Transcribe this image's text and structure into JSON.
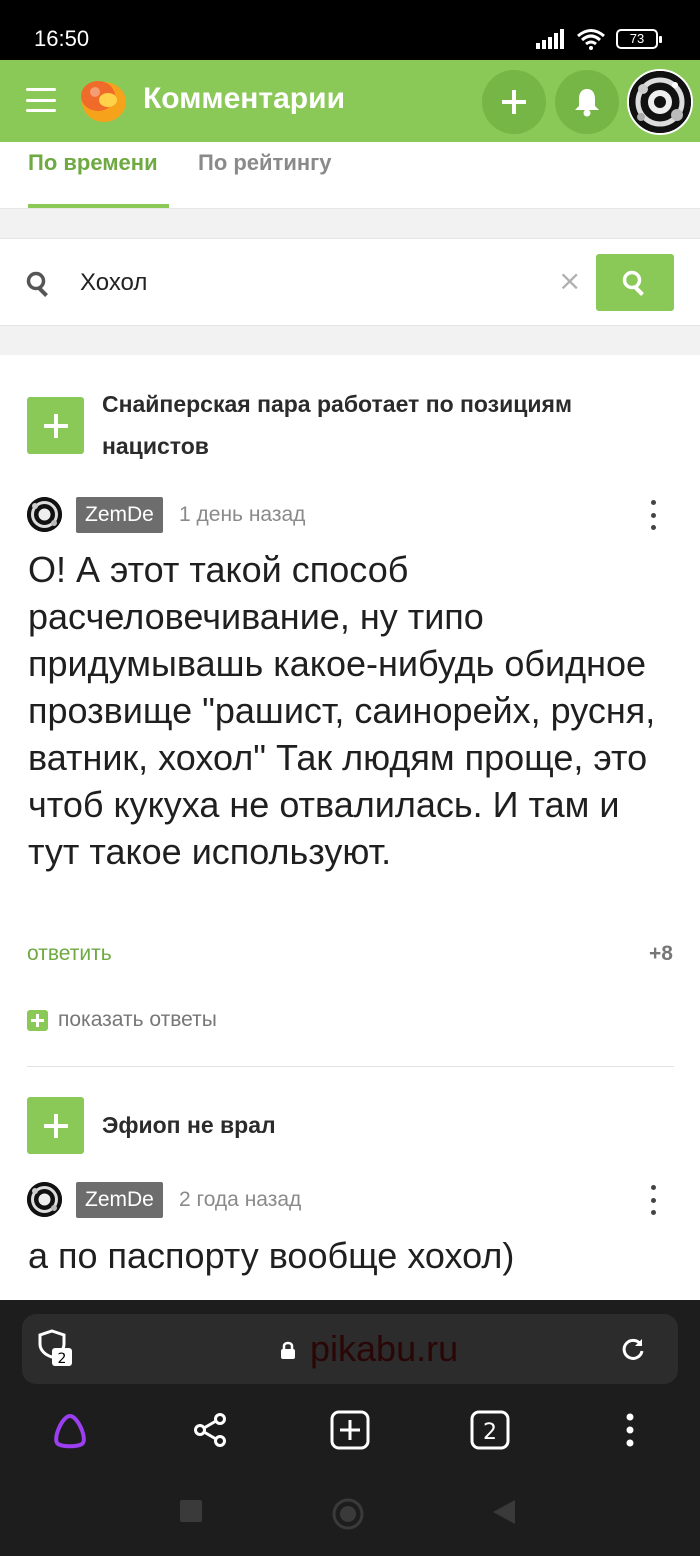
{
  "status_bar": {
    "time": "16:50",
    "battery": "73"
  },
  "header": {
    "title": "Комментарии"
  },
  "tabs": [
    {
      "label": "По времени"
    },
    {
      "label": "По рейтингу"
    }
  ],
  "search": {
    "value": "Хохол",
    "clear": "×"
  },
  "posts": [
    {
      "title": "Снайперская пара работает по позициям нацистов",
      "comment": {
        "author": "ZemDe",
        "time": "1 день назад",
        "text": "О! А этот такой способ расчеловечивание, ну типо придумываш­ь какое-нибудь обидное прозвище \"рашист, саинорейх, русня, ватник, хохол\" Так людям проще, это чтоб кукуха не отвалилась. И там и тут такое используют.",
        "reply": "ответить",
        "rating": "+8",
        "show_replies": "показать ответы"
      }
    },
    {
      "title": "Эфиоп не врал",
      "comment": {
        "author": "ZemDe",
        "time": "2 года назад",
        "text": "а по паспорту вообще хохол)"
      }
    }
  ],
  "browser": {
    "url": "pikabu.ru",
    "shield_count": "2",
    "tabs_count": "2"
  },
  "colors": {
    "accent": "#8ac858",
    "accent_dark": "#76b646",
    "link": "#6ea942"
  }
}
